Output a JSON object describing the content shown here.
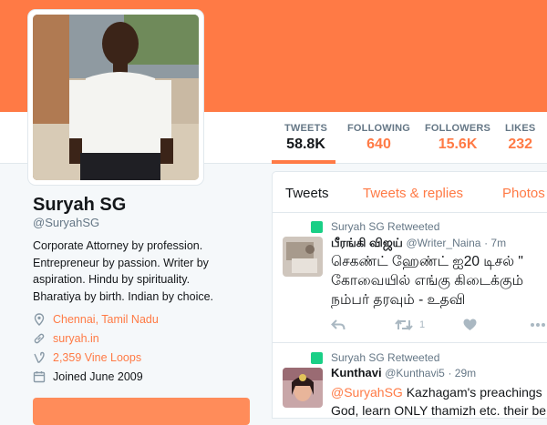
{
  "colors": {
    "accent": "#ff7a45",
    "retweet_green": "#19cf86"
  },
  "profile": {
    "name": "Suryah SG",
    "handle": "@SuryahSG",
    "bio": "Corporate Attorney by profession. Entrepreneur by passion. Writer by aspiration. Hindu by spirituality. Bharatiya by birth. Indian by choice.",
    "location": "Chennai, Tamil Nadu",
    "website": "suryah.in",
    "vine_loops": "2,359 Vine Loops",
    "joined": "Joined June 2009"
  },
  "stats": [
    {
      "label": "TWEETS",
      "value": "58.8K"
    },
    {
      "label": "FOLLOWING",
      "value": "640"
    },
    {
      "label": "FOLLOWERS",
      "value": "15.6K"
    },
    {
      "label": "LIKES",
      "value": "232"
    }
  ],
  "tabs": [
    "Tweets",
    "Tweets & replies",
    "Photos"
  ],
  "tweets": [
    {
      "retweeted_by": "Suryah SG Retweeted",
      "author": "பீரங்கி விஜய்",
      "handle": "@Writer_Naina",
      "time": "· 7m",
      "lines": [
        "செகண்ட் ஹேண்ட் ஐ20 டிசல் \"",
        "கோவையில் எங்கு கிடைக்கும்",
        "நம்பர் தரவும் - உதவி"
      ],
      "retweets": "1"
    },
    {
      "retweeted_by": "Suryah SG Retweeted",
      "author": "Kunthavi",
      "handle": "@Kunthavi5",
      "time": "· 29m",
      "mention": "@SuryahSG",
      "line1_rest": " Kazhagam's preachings",
      "line2": "God, learn ONLY thamizh etc. their be"
    }
  ],
  "icons": [
    "location-pin-icon",
    "link-icon",
    "vine-icon",
    "calendar-icon",
    "retweet-icon",
    "reply-icon",
    "heart-icon",
    "more-icon"
  ]
}
